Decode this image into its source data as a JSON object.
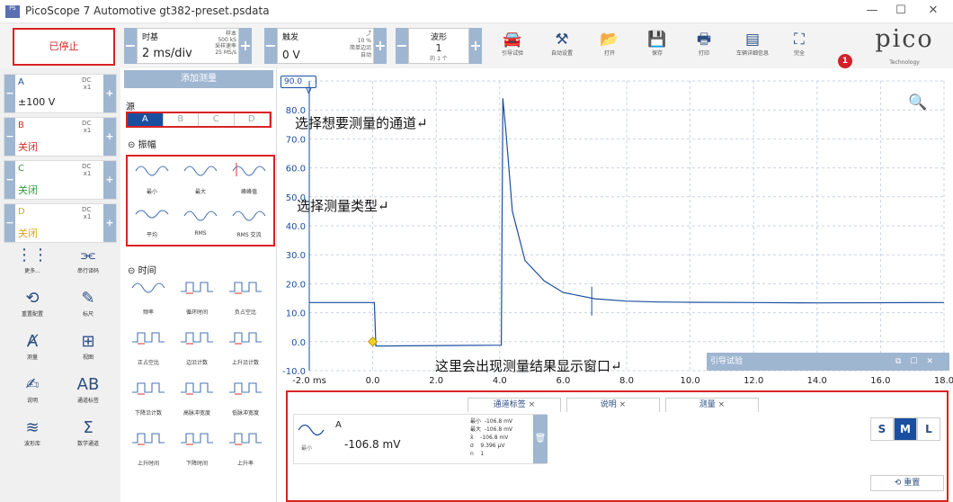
{
  "window": {
    "title": "PicoScope 7 Automotive gt382-preset.psdata",
    "logo": "PS"
  },
  "toolbar": {
    "stopped": "已停止",
    "timebase_label": "时基",
    "timebase_value": "2 ms/div",
    "samples_label": "样本",
    "samples_value": "500 kS",
    "rate_label": "采样速率",
    "rate_value": "25 MS/s",
    "trigger_label": "触发",
    "trigger_value": "0 V",
    "trigger_percent": "10 %",
    "trigger_mode": "简单边沿",
    "trigger_auto": "自动",
    "wave_label": "波形",
    "wave_value": "1",
    "wave_sub": "的 1 个",
    "buttons": [
      "引导试验",
      "自动设置",
      "打开",
      "保存",
      "打印",
      "车辆详细信息",
      "完全"
    ],
    "brand": "pico",
    "brand_sub": "Technology",
    "badge": "1"
  },
  "channels": [
    {
      "name": "A",
      "coupling": "DC",
      "mult": "x1",
      "value": "±100 V",
      "color": "#1a4fa0"
    },
    {
      "name": "B",
      "coupling": "DC",
      "mult": "x1",
      "value": "关闭",
      "color": "#d0302a"
    },
    {
      "name": "C",
      "coupling": "DC",
      "mult": "x1",
      "value": "关闭",
      "color": "#2f9a3a"
    },
    {
      "name": "D",
      "coupling": "DC",
      "mult": "x1",
      "value": "关闭",
      "color": "#d8a520"
    }
  ],
  "tools": [
    "更多...",
    "串行译码",
    "重置配置",
    "标尺",
    "测量",
    "视图",
    "说明",
    "通道标签",
    "波形库",
    "数学通道"
  ],
  "measure": {
    "add": "添加测量",
    "source": "源",
    "sources": [
      "A",
      "B",
      "C",
      "D"
    ],
    "amplitude": "振幅",
    "amp_items": [
      "最小",
      "最大",
      "峰峰值",
      "平均",
      "RMS",
      "RMS 交流"
    ],
    "time": "时间",
    "time_items": [
      "频率",
      "循环时间",
      "负占空比",
      "正占空比",
      "边沿计数",
      "上升沿计数",
      "下降沿计数",
      "高脉冲宽度",
      "低脉冲宽度",
      "上升时间",
      "下降时间",
      "上升率"
    ]
  },
  "annotations": {
    "channel": "选择想要测量的通道",
    "type": "选择测量类型",
    "result": "这里会出现测量结果显示窗口"
  },
  "scope": {
    "unit": "V",
    "y_ticks": [
      "90.0",
      "80.0",
      "70.0",
      "60.0",
      "50.0",
      "40.0",
      "30.0",
      "20.0",
      "10.0",
      "0.0",
      "-10.0"
    ],
    "x_ticks": [
      "-2.0 ms",
      "0.0",
      "2.0",
      "4.0",
      "6.0",
      "8.0",
      "10.0",
      "12.0",
      "14.0",
      "16.0",
      "18.0"
    ]
  },
  "guide_bar": {
    "title": "引导试验"
  },
  "results": {
    "tabs": [
      "通道标签",
      "说明",
      "测量"
    ],
    "channel": "A",
    "stat_label": "最小",
    "value": "-106.8 mV",
    "stats": [
      "最小  -106.8 mV",
      "最大  -106.8 mV",
      "x̄    -106.8 mV",
      "σ    9.396 µV",
      "n    1"
    ],
    "sizes": [
      "S",
      "M",
      "L"
    ],
    "reset": "重置"
  },
  "chart_data": {
    "type": "line",
    "xlabel": "",
    "ylabel": "V",
    "xlim": [
      -2,
      18
    ],
    "ylim": [
      -10,
      90
    ],
    "x_unit": "ms",
    "series": [
      {
        "values": [
          [
            -2,
            13.5
          ],
          [
            0.05,
            13.5
          ],
          [
            0.1,
            -1.5
          ],
          [
            4.05,
            -1.2
          ],
          [
            4.1,
            84
          ],
          [
            4.2,
            72
          ],
          [
            4.4,
            45
          ],
          [
            4.8,
            28
          ],
          [
            5.4,
            21
          ],
          [
            6,
            17
          ],
          [
            7,
            14.8
          ],
          [
            8,
            14
          ],
          [
            9,
            13.7
          ],
          [
            10,
            13.6
          ],
          [
            12,
            13.5
          ],
          [
            14,
            13.4
          ],
          [
            18,
            13.5
          ]
        ]
      }
    ]
  }
}
